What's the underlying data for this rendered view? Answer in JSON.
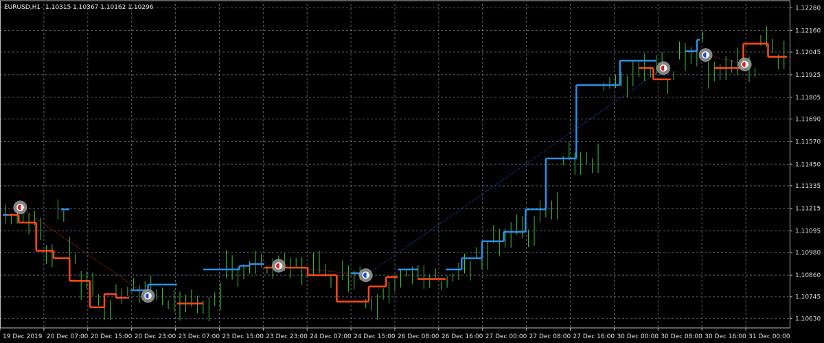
{
  "header": {
    "symbol": "EURUSD,H1",
    "ohlc": "1.10315 1.10367 1.10162 1.10296"
  },
  "colors": {
    "background": "#000000",
    "grid": "#6e7b8b",
    "up_bars": "#3ec43e",
    "blue_line": "#2b8fe8",
    "red_line": "#ff4a12",
    "frame": "#bfbfbf"
  },
  "chart_data": {
    "type": "line",
    "title": "",
    "ylim": [
      1.1058,
      1.123
    ],
    "y_ticks": [
      "1.12280",
      "1.12160",
      "1.12045",
      "1.11925",
      "1.11805",
      "1.11690",
      "1.11570",
      "1.11450",
      "1.11335",
      "1.11215",
      "1.11095",
      "1.10980",
      "1.10860",
      "1.10745",
      "1.10630"
    ],
    "x_ticks": [
      "19 Dec 2019",
      "20 Dec 07:00",
      "20 Dec 15:00",
      "20 Dec 23:00",
      "23 Dec 07:00",
      "23 Dec 15:00",
      "23 Dec 23:00",
      "24 Dec 07:00",
      "24 Dec 15:00",
      "26 Dec 08:00",
      "26 Dec 16:00",
      "27 Dec 00:00",
      "27 Dec 08:00",
      "27 Dec 16:00",
      "30 Dec 00:00",
      "30 Dec 08:00",
      "30 Dec 16:00",
      "31 Dec 00:00"
    ],
    "series": [
      {
        "color": "red",
        "segments": [
          [
            0,
            1.1118,
            11,
            1.1118
          ],
          [
            11,
            1.1114,
            15,
            1.1114
          ],
          [
            15,
            1.1114,
            23,
            1.1114
          ],
          [
            23,
            1.1099,
            35,
            1.1099
          ],
          [
            35,
            1.1095,
            46,
            1.1095
          ],
          [
            46,
            1.1083,
            60,
            1.1083
          ],
          [
            60,
            1.1069,
            70,
            1.1069
          ],
          [
            70,
            1.1076,
            78,
            1.1076
          ],
          [
            78,
            1.1074,
            87,
            1.1074
          ],
          [
            120,
            1.1071,
            138,
            1.1071
          ],
          [
            180,
            1.109,
            210,
            1.109
          ],
          [
            210,
            1.1086,
            230,
            1.1086
          ],
          [
            230,
            1.1072,
            252,
            1.1072
          ],
          [
            252,
            1.108,
            264,
            1.108
          ],
          [
            264,
            1.1085,
            272,
            1.1085
          ],
          [
            286,
            1.1084,
            305,
            1.1084
          ],
          [
            438,
            1.1196,
            448,
            1.1196
          ],
          [
            448,
            1.119,
            460,
            1.119
          ],
          [
            490,
            1.1196,
            510,
            1.1196
          ],
          [
            510,
            1.1209,
            527,
            1.1209
          ],
          [
            527,
            1.1202,
            540,
            1.1202
          ]
        ]
      },
      {
        "color": "blue",
        "segments": [
          [
            0,
            1.1118,
            4,
            1.1118
          ],
          [
            40,
            1.1121,
            46,
            1.1121
          ],
          [
            88,
            1.1078,
            100,
            1.1078
          ],
          [
            100,
            1.1081,
            120,
            1.1081
          ],
          [
            138,
            1.1089,
            163,
            1.1089
          ],
          [
            163,
            1.1091,
            170,
            1.1091
          ],
          [
            170,
            1.1092,
            180,
            1.1092
          ],
          [
            240,
            1.1087,
            252,
            1.1087
          ],
          [
            272,
            1.1089,
            286,
            1.1089
          ],
          [
            305,
            1.1089,
            316,
            1.1089
          ],
          [
            316,
            1.1095,
            330,
            1.1095
          ],
          [
            330,
            1.1104,
            345,
            1.1104
          ],
          [
            345,
            1.1109,
            360,
            1.1109
          ],
          [
            360,
            1.1121,
            374,
            1.1121
          ],
          [
            374,
            1.1148,
            395,
            1.1148
          ],
          [
            395,
            1.1187,
            425,
            1.1187
          ],
          [
            425,
            1.12,
            450,
            1.12
          ],
          [
            470,
            1.1205,
            478,
            1.1205
          ],
          [
            478,
            1.1211,
            480,
            1.1211
          ]
        ]
      }
    ],
    "trade_markers": [
      {
        "type": "sell",
        "x": 12,
        "y": 1.1122
      },
      {
        "type": "buy",
        "x": 100,
        "y": 1.1075
      },
      {
        "type": "sell",
        "x": 190,
        "y": 1.1091
      },
      {
        "type": "buy",
        "x": 250,
        "y": 1.1086
      },
      {
        "type": "sell",
        "x": 455,
        "y": 1.1196
      },
      {
        "type": "buy",
        "x": 484,
        "y": 1.1203
      },
      {
        "type": "sell",
        "x": 511,
        "y": 1.1198
      }
    ],
    "trade_links": [
      [
        12,
        1.1122,
        100,
        1.1075,
        "red"
      ],
      [
        190,
        1.1091,
        250,
        1.1086,
        "red"
      ],
      [
        250,
        1.1086,
        455,
        1.1196,
        "blue"
      ],
      [
        484,
        1.1203,
        511,
        1.1198,
        "red"
      ]
    ]
  }
}
